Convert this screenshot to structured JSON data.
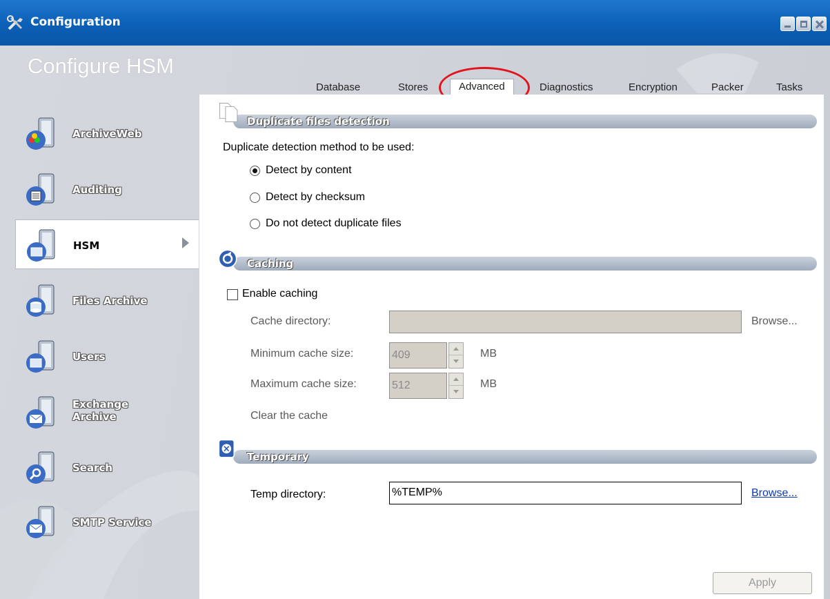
{
  "window": {
    "title": "Configuration"
  },
  "heading": "Configure HSM",
  "tabs": [
    {
      "label": "Database"
    },
    {
      "label": "Stores"
    },
    {
      "label": "Advanced",
      "active": true
    },
    {
      "label": "Diagnostics"
    },
    {
      "label": "Encryption"
    },
    {
      "label": "Packer"
    },
    {
      "label": "Tasks"
    }
  ],
  "sidebar": {
    "items": [
      {
        "label": "ArchiveWeb",
        "icon": "archiveweb-icon"
      },
      {
        "label": "Auditing",
        "icon": "auditing-icon"
      },
      {
        "label": "HSM",
        "icon": "hsm-icon",
        "active": true
      },
      {
        "label": "Files Archive",
        "icon": "files-archive-icon"
      },
      {
        "label": "Users",
        "icon": "users-icon"
      },
      {
        "label": "Exchange Archive",
        "icon": "exchange-archive-icon"
      },
      {
        "label": "Search",
        "icon": "search-icon"
      },
      {
        "label": "SMTP Service",
        "icon": "smtp-service-icon"
      }
    ]
  },
  "duplicate": {
    "title": "Duplicate files detection",
    "prompt": "Duplicate detection method to be used:",
    "options": [
      {
        "label": "Detect by content",
        "selected": true
      },
      {
        "label": "Detect by checksum",
        "selected": false
      },
      {
        "label": "Do not detect duplicate files",
        "selected": false
      }
    ]
  },
  "caching": {
    "title": "Caching",
    "enable_label": "Enable caching",
    "enabled": false,
    "cache_dir_label": "Cache directory:",
    "cache_dir_value": "",
    "browse_label": "Browse...",
    "min_label": "Minimum cache size:",
    "min_value": "409",
    "max_label": "Maximum cache size:",
    "max_value": "512",
    "unit": "MB",
    "clear_label": "Clear the cache"
  },
  "temporary": {
    "title": "Temporary",
    "dir_label": "Temp directory:",
    "dir_value": "%TEMP%",
    "browse_label": "Browse..."
  },
  "apply_label": "Apply",
  "colors": {
    "titlebar": "#0b5fb6",
    "highlight": "#e1141c",
    "link": "#0a3ab4"
  }
}
